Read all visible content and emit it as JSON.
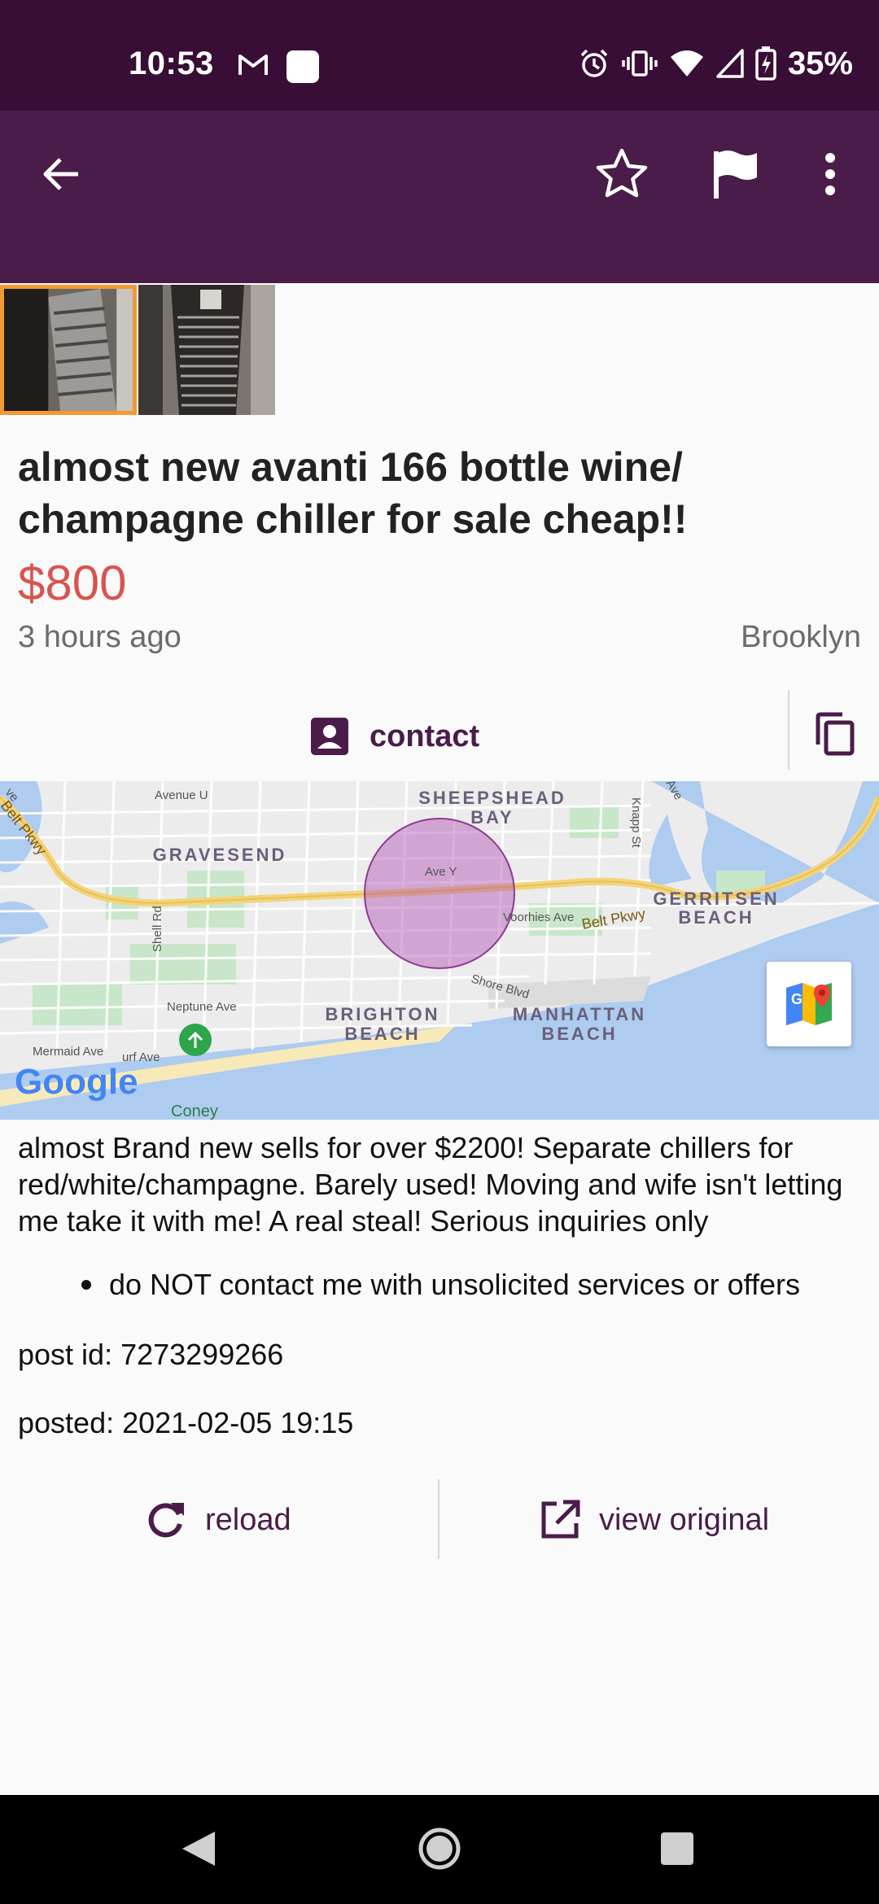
{
  "status_bar": {
    "time": "10:53",
    "battery_percent": "35%",
    "icons": [
      "gmail-icon",
      "app-square-icon",
      "alarm-icon",
      "vibrate-icon",
      "wifi-icon",
      "signal-icon",
      "battery-icon"
    ]
  },
  "app_bar": {
    "icons": [
      "back-arrow-icon",
      "star-outline-icon",
      "flag-icon",
      "more-vert-icon"
    ],
    "colors": {
      "status": "#380d36",
      "bar": "#4a1c49"
    }
  },
  "gallery": {
    "count": 2,
    "selected_index": 0,
    "selected_border": "#f29a35"
  },
  "listing": {
    "title": "almost new avanti 166 bottle wine/ champagne chiller for sale cheap!!",
    "price": "$800",
    "time_ago": "3 hours ago",
    "location": "Brooklyn",
    "price_color": "#d9534f"
  },
  "contact": {
    "label": "contact"
  },
  "map": {
    "labels": {
      "sheepshead": "SHEEPSHEAD",
      "bay": "BAY",
      "gravesend": "GRAVESEND",
      "gerritsen": "GERRITSEN",
      "gerritsen_beach": "BEACH",
      "brighton": "BRIGHTON",
      "brighton_beach": "BEACH",
      "manhattan": "MANHATTAN",
      "manhattan_beach": "BEACH",
      "belt_pkwy_left": "Belt Pkwy",
      "belt_pkwy_right": "Belt Pkwy",
      "avenue_u": "Avenue U",
      "ave_y": "Ave Y",
      "voorhies": "Voorhies Ave",
      "shore_blvd": "Shore Blvd",
      "neptune": "Neptune Ave",
      "mermaid": "Mermaid Ave",
      "surf": "urf Ave",
      "knapp": "Knapp St",
      "shell": "Shell Rd",
      "ave_tr": "Ave",
      "ave_tl": "ve",
      "coney": "Coney",
      "google": "Google"
    }
  },
  "description": {
    "body": "almost Brand new sells for over $2200! Separate chillers for red/white/champagne. Barely used! Moving and wife isn't letting me take it with me! A real steal! Serious inquiries only",
    "bullet": "do NOT contact me with unsolicited services or offers",
    "post_id": "post id: 7273299266",
    "posted": "posted: 2021-02-05 19:15"
  },
  "actions": {
    "reload": "reload",
    "view_original": "view original"
  },
  "nav_bar": {
    "icons": [
      "back-triangle-icon",
      "home-circle-icon",
      "recents-square-icon"
    ]
  }
}
